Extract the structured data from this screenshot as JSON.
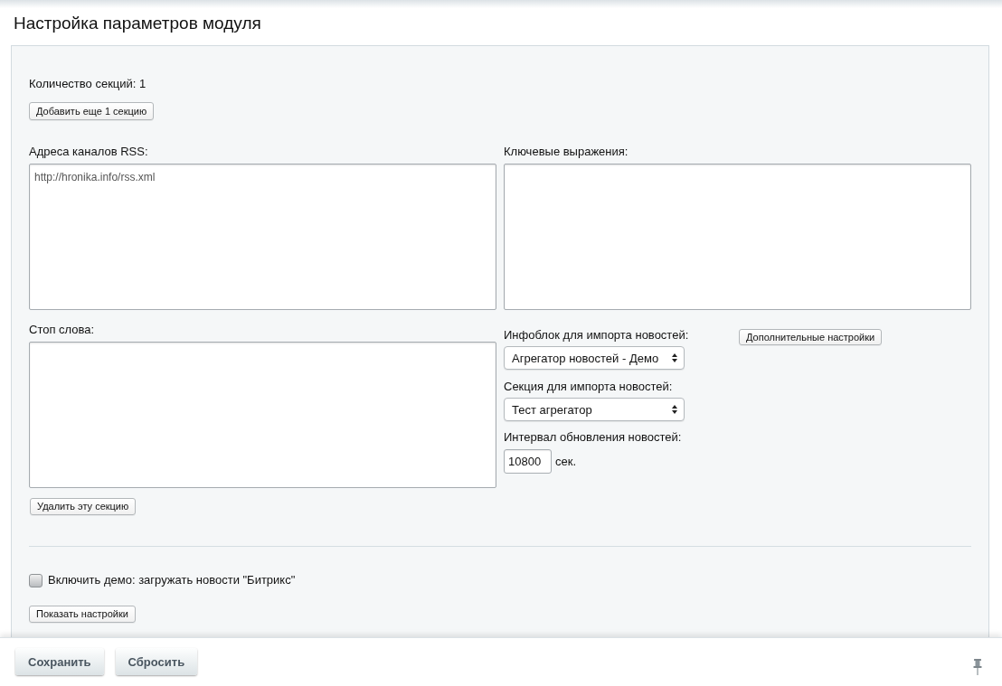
{
  "title": "Настройка параметров модуля",
  "section_count": "Количество секций: 1",
  "add_section_button": "Добавить еще 1 секцию",
  "section": {
    "rss": {
      "label": "Адреса каналов RSS:",
      "value": "http://hronika.info/rss.xml"
    },
    "keywords": {
      "label": "Ключевые выражения:"
    },
    "stop_words": {
      "label": "Стоп слова:"
    },
    "iblock": {
      "label": "Инфоблок для импорта новостей:",
      "value": "Агрегатор новостей - Демо"
    },
    "extra_settings_button": "Дополнительные настройки",
    "section_select": {
      "label": "Секция для импорта новостей:",
      "value": "Тест агрегатор"
    },
    "interval": {
      "label": "Интервал обновления новостей:",
      "value": "10800",
      "unit": "сек."
    },
    "delete_button": "Удалить эту секцию"
  },
  "demo": {
    "label": "Включить демо: загружать новости \"Битрикс\"",
    "checked": false
  },
  "show_settings_button": "Показать настройки",
  "footer": {
    "buttons": [
      {
        "label": "Сохранить"
      },
      {
        "label": "Сбросить"
      }
    ]
  }
}
